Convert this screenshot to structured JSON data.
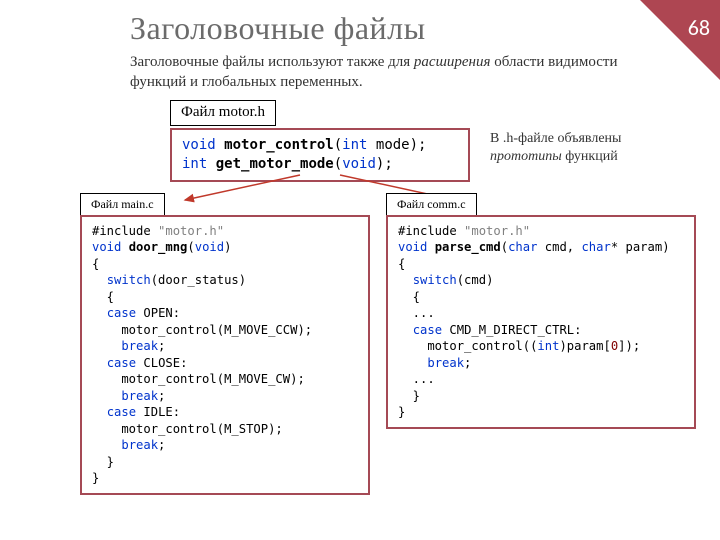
{
  "page_number": "68",
  "title": "Заголовочные файлы",
  "subtitle_part1": "Заголовочные файлы используют также для ",
  "subtitle_em": "расширения",
  "subtitle_part2": " области видимости функций и глобальных переменных.",
  "labels": {
    "motorh": "Файл motor.h",
    "mainc": "Файл main.c",
    "commc": "Файл comm.c"
  },
  "note_part1": "В .h-файле объявлены ",
  "note_em": "прототипы",
  "note_part2": " функций",
  "code": {
    "motorh": {
      "l1_kw1": "void",
      "l1_fn": "motor_control",
      "l1_p1": "(",
      "l1_kw2": "int",
      "l1_rest": " mode);",
      "l2_kw1": "int",
      "l2_fn": "get_motor_mode",
      "l2_p1": "(",
      "l2_kw2": "void",
      "l2_rest": ");"
    },
    "mainc": {
      "l1_pre": "#include ",
      "l1_str": "\"motor.h\"",
      "l2_kw": "void ",
      "l2_fn": "door_mng",
      "l2_p": "(",
      "l2_kw2": "void",
      "l2_rest": ")",
      "l3": "{",
      "l4_ind": "  ",
      "l4_kw": "switch",
      "l4_rest": "(door_status)",
      "l5": "  {",
      "l6_ind": "  ",
      "l6_kw": "case",
      "l6_sp": " ",
      "l6_id": "OPEN",
      "l6_c": ":",
      "l7": "    motor_control(M_MOVE_CCW);",
      "l8_ind": "    ",
      "l8_kw": "break",
      "l8_s": ";",
      "l9_ind": "  ",
      "l9_kw": "case",
      "l9_sp": " ",
      "l9_id": "CLOSE",
      "l9_c": ":",
      "l10": "    motor_control(M_MOVE_CW);",
      "l11_ind": "    ",
      "l11_kw": "break",
      "l11_s": ";",
      "l12_ind": "  ",
      "l12_kw": "case",
      "l12_sp": " ",
      "l12_id": "IDLE",
      "l12_c": ":",
      "l13": "    motor_control(M_STOP);",
      "l14_ind": "    ",
      "l14_kw": "break",
      "l14_s": ";",
      "l15": "  }",
      "l16": "}"
    },
    "commc": {
      "l1_pre": "#include ",
      "l1_str": "\"motor.h\"",
      "l2_kw": "void ",
      "l2_fn": "parse_cmd",
      "l2_p": "(",
      "l2_t1": "char",
      "l2_a1": " cmd, ",
      "l2_t2": "char",
      "l2_a2": "* param)",
      "l3": "{",
      "l4_ind": "  ",
      "l4_kw": "switch",
      "l4_rest": "(cmd)",
      "l5": "  {",
      "l6": "  ...",
      "l7_ind": "  ",
      "l7_kw": "case",
      "l7_sp": " ",
      "l7_id": "CMD_M_DIRECT_CTRL",
      "l7_c": ":",
      "l8_a": "    motor_control((",
      "l8_t": "int",
      "l8_b": ")param[",
      "l8_n": "0",
      "l8_c": "]);",
      "l9_ind": "    ",
      "l9_kw": "break",
      "l9_s": ";",
      "l10": "  ...",
      "l11": "  }",
      "l12": "}"
    }
  }
}
